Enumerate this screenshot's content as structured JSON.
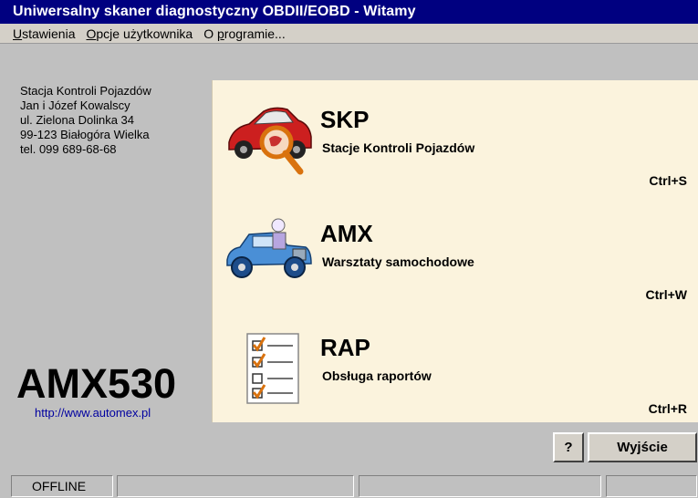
{
  "window": {
    "title": "Uniwersalny skaner diagnostyczny OBDII/EOBD - Witamy"
  },
  "menu": [
    {
      "pre": "",
      "ul": "U",
      "post": "stawienia"
    },
    {
      "pre": "",
      "ul": "O",
      "post": "pcje użytkownika"
    },
    {
      "pre": "O ",
      "ul": "p",
      "post": "rogramie..."
    }
  ],
  "station": {
    "lines": [
      "Stacja Kontroli Pojazdów",
      "Jan i Józef Kowalscy",
      "ul. Zielona Dolinka 34",
      "99-123 Białogóra Wielka",
      "tel. 099 689-68-68"
    ]
  },
  "brand": {
    "logo": "AMX530",
    "url": "http://www.automex.pl"
  },
  "modules": [
    {
      "name": "SKP",
      "desc": "Stacje Kontroli Pojazdów",
      "shortcut": "Ctrl+S",
      "icon": "car-magnifier-icon"
    },
    {
      "name": "AMX",
      "desc": "Warsztaty samochodowe",
      "shortcut": "Ctrl+W",
      "icon": "car-mechanic-icon"
    },
    {
      "name": "RAP",
      "desc": "Obsługa raportów",
      "shortcut": "Ctrl+R",
      "icon": "report-checklist-icon"
    }
  ],
  "buttons": {
    "help": "?",
    "exit": "Wyjście"
  },
  "status": {
    "connection": "OFFLINE",
    "cell2": "",
    "cell3": "",
    "cell4": ""
  }
}
